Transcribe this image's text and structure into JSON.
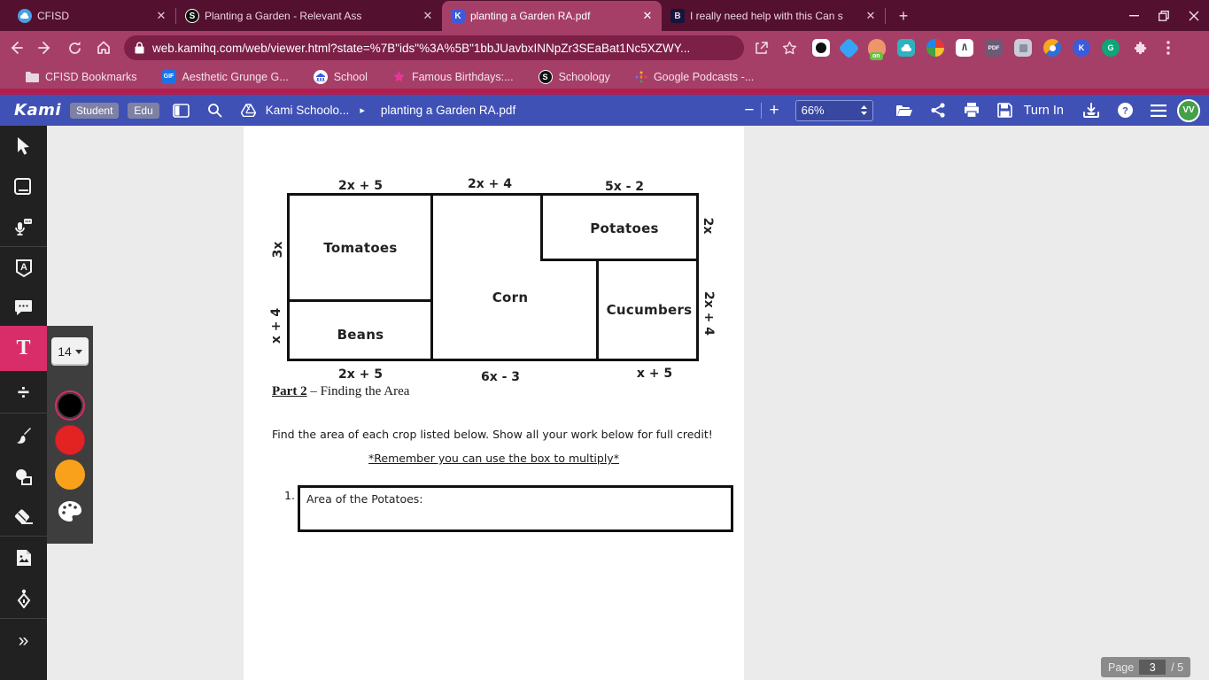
{
  "browser": {
    "tabs": [
      {
        "title": "CFISD",
        "favicon": "cloud"
      },
      {
        "title": "Planting a Garden - Relevant Ass",
        "favicon": "S"
      },
      {
        "title": "planting a Garden RA.pdf",
        "favicon": "K"
      },
      {
        "title": "I really need help with this Can s",
        "favicon": "B"
      }
    ],
    "close_glyph": "✕",
    "new_tab_glyph": "+",
    "url": "web.kamihq.com/web/viewer.html?state=%7B\"ids\"%3A%5B\"1bbJUavbxINNpZr3SEaBat1Nc5XZWY...",
    "extensions": {
      "on_badge": "on",
      "slash_glyph": "/\\",
      "pdf_label": "PDF",
      "kami_letter": "K",
      "grammarly_letter": "G",
      "gif_label": "GIF",
      "schoology_letter": "S",
      "brainly_letter": "B"
    },
    "bookmarks": [
      {
        "label": "CFISD Bookmarks"
      },
      {
        "label": "Aesthetic Grunge G..."
      },
      {
        "label": "School"
      },
      {
        "label": "Famous Birthdays:..."
      },
      {
        "label": "Schoology"
      },
      {
        "label": "Google Podcasts -..."
      }
    ]
  },
  "kami": {
    "logo": "Kami",
    "badge_student": "Student",
    "badge_edu": "Edu",
    "breadcrumb": "Kami Schoolo...",
    "breadcrumb_arrow": "▸",
    "doc_title": "planting a Garden RA.pdf",
    "zoom_out": "−",
    "zoom_in": "+",
    "zoom_value": "66%",
    "turn_in_label": "Turn In",
    "avatar_initials": "VV"
  },
  "tools": {
    "font_size": "14",
    "text_tool_letter": "T",
    "divide_glyph": "÷",
    "collapse_glyph": "»",
    "swatch_colors": [
      "#000000",
      "#e32222",
      "#f9a11b"
    ],
    "active_tool_color": "#d92d6a"
  },
  "pdf": {
    "part2_label": "Part 2",
    "part2_rest": "– Finding the Area",
    "instructions": "Find the area of each crop listed below. Show all your work below for full credit!",
    "reminder": "*Remember you can use the box to multiply*",
    "q1_number": "1.",
    "q1_text": "Area of the Potatoes:",
    "diagram": {
      "crops": {
        "tomatoes": "Tomatoes",
        "beans": "Beans",
        "corn": "Corn",
        "potatoes": "Potatoes",
        "cucumbers": "Cucumbers"
      },
      "dims": {
        "top_left": "2x + 5",
        "top_mid": "2x + 4",
        "top_right": "5x - 2",
        "left_top": "3x",
        "left_bottom": "x + 4",
        "right_top": "2x",
        "right_bottom": "2x + 4",
        "bottom_left": "2x + 5",
        "bottom_mid": "6x - 3",
        "bottom_right": "x + 5"
      }
    }
  },
  "page_indicator": {
    "label": "Page",
    "current": "3",
    "total": "/ 5"
  },
  "colors": {
    "chrome_frame": "#53102f",
    "chrome_toolbar": "#a63f68",
    "accent_strip": "#b01e50",
    "kami_indigo": "#3f51b5",
    "active_tool_pink": "#d92d6a",
    "avatar_green": "#43a047"
  }
}
